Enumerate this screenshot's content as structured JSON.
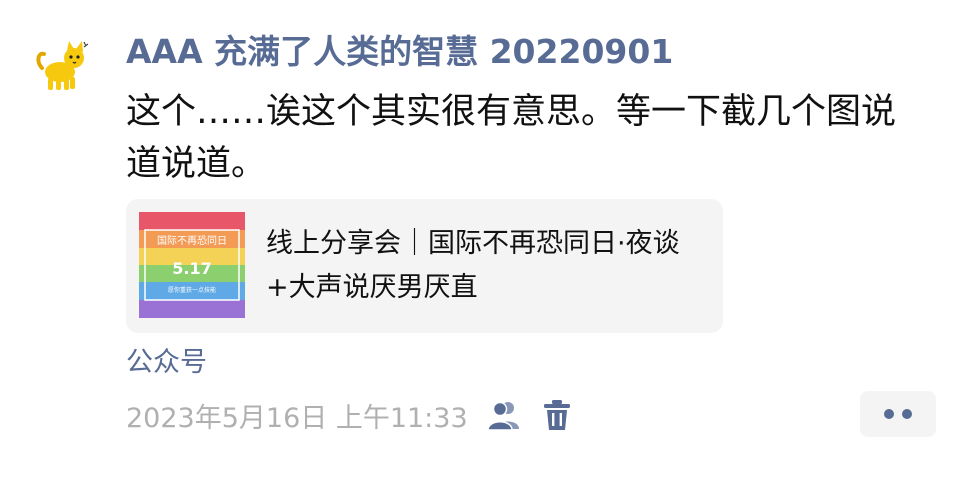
{
  "post": {
    "author_name": "AAA 充满了人类的智慧 20220901",
    "text": "这个……诶这个其实很有意思。等一下截几个图说道说道。",
    "avatar_icon": "yellow-cat-icon"
  },
  "share": {
    "title": "线上分享会｜国际不再恐同日·夜谈+大声说厌男厌直",
    "thumbnail": {
      "top_text": "国际不再恐同日",
      "date_text": "5.17",
      "bottom_text": "愿你重获一点技能",
      "stripe_colors": [
        "#e8566a",
        "#f39a55",
        "#f3d255",
        "#8bcf6f",
        "#5ea9e6",
        "#9a72d6"
      ]
    }
  },
  "source_label": "公众号",
  "meta": {
    "timestamp": "2023年5月16日 上午11:33",
    "visibility_icon": "people-icon",
    "delete_icon": "trash-icon",
    "more_icon": "more-dots-icon",
    "accent_color": "#576b95"
  }
}
